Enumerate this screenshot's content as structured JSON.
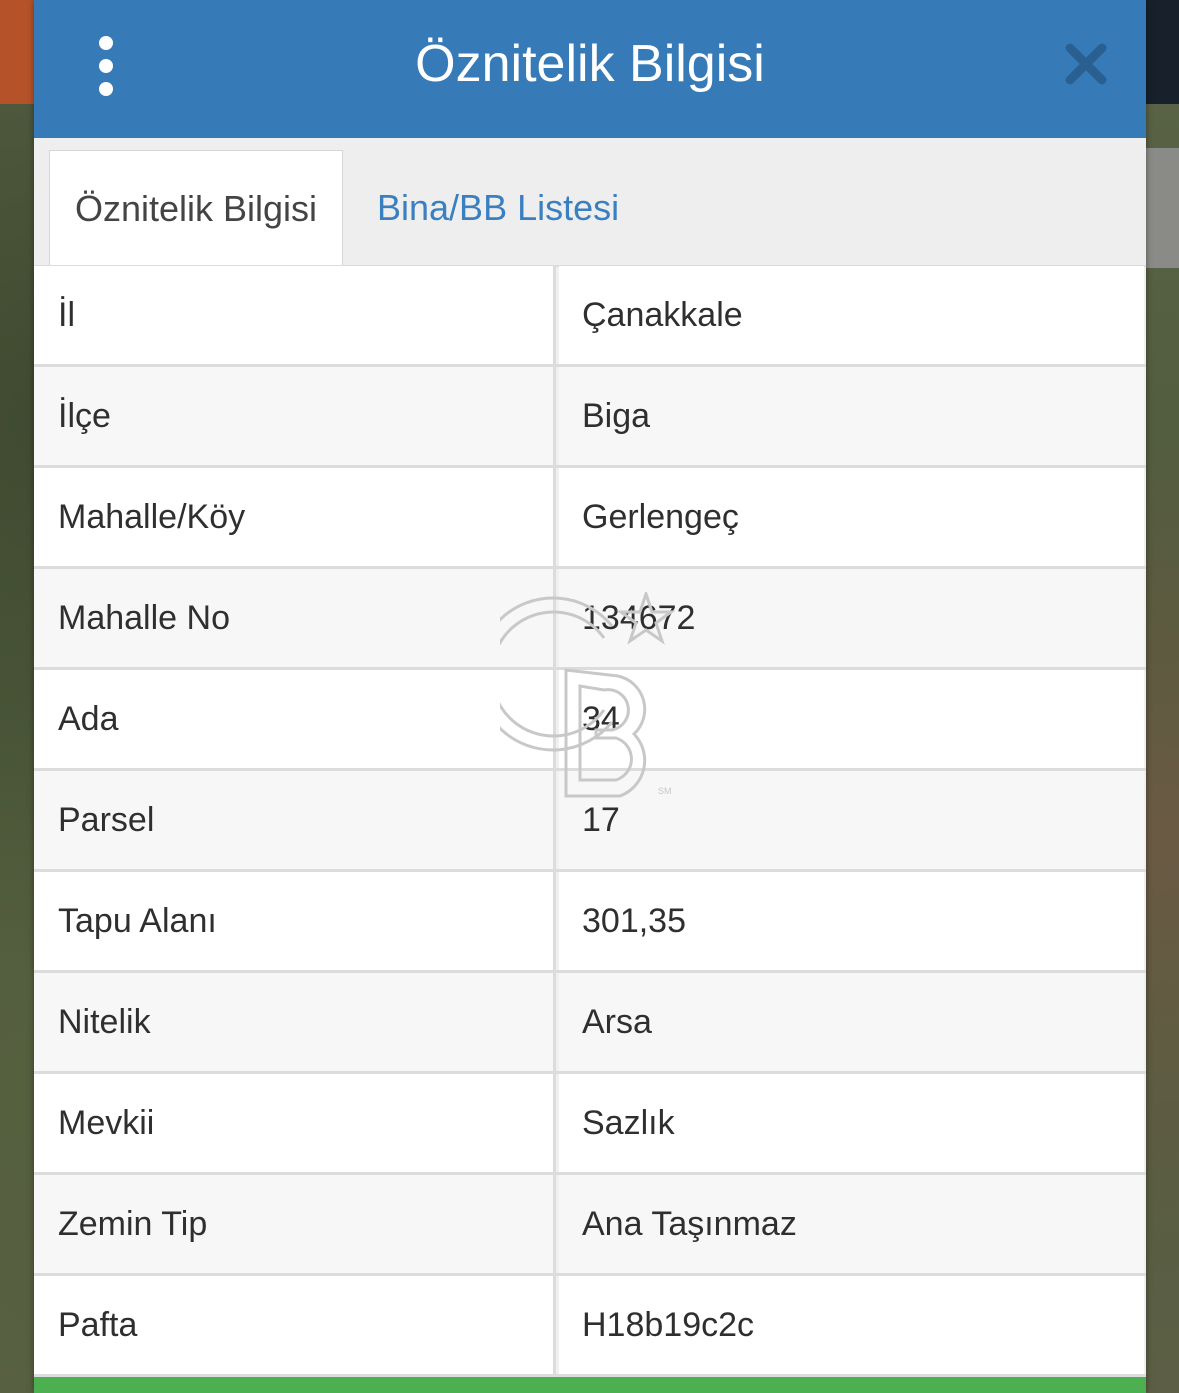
{
  "header": {
    "title": "Öznitelik Bilgisi",
    "menu_icon": "vertical-ellipsis-icon",
    "close_icon": "close-icon"
  },
  "tabs": [
    {
      "label": "Öznitelik Bilgisi",
      "active": true
    },
    {
      "label": "Bina/BB Listesi",
      "active": false
    }
  ],
  "attributes": [
    {
      "key": "İl",
      "value": "Çanakkale"
    },
    {
      "key": "İlçe",
      "value": "Biga"
    },
    {
      "key": "Mahalle/Köy",
      "value": "Gerlengeç"
    },
    {
      "key": "Mahalle No",
      "value": "134672"
    },
    {
      "key": "Ada",
      "value": "34"
    },
    {
      "key": "Parsel",
      "value": "17"
    },
    {
      "key": "Tapu Alanı",
      "value": "301,35"
    },
    {
      "key": "Nitelik",
      "value": "Arsa"
    },
    {
      "key": "Mevkii",
      "value": "Sazlık"
    },
    {
      "key": "Zemin Tip",
      "value": "Ana Taşınmaz"
    },
    {
      "key": "Pafta",
      "value": "H18b19c2c"
    }
  ],
  "watermark": {
    "icon": "cb-logo-watermark-icon",
    "mark": "SM"
  },
  "colors": {
    "header": "#367ab8",
    "tab_link": "#3a7fc0",
    "footer_bar": "#4caf50"
  }
}
